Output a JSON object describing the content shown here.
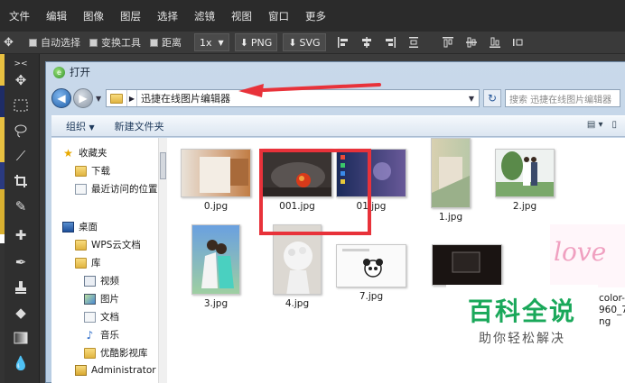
{
  "menu": [
    "文件",
    "编辑",
    "图像",
    "图层",
    "选择",
    "滤镜",
    "视图",
    "窗口",
    "更多"
  ],
  "options": {
    "auto_select": "自动选择",
    "transform_tools": "变换工具",
    "distance": "距离",
    "zoom": "1x",
    "export_png": "PNG",
    "export_svg": "SVG"
  },
  "dialog": {
    "title": "打开",
    "address": "迅捷在线图片编辑器",
    "search_placeholder": "搜索 迅捷在线图片编辑器",
    "organize": "组织",
    "new_folder": "新建文件夹"
  },
  "nav_items": [
    {
      "label": "收藏夹",
      "icon": "star-icon"
    },
    {
      "label": "下载",
      "icon": "folder-icon"
    },
    {
      "label": "最近访问的位置",
      "icon": "recent-places-icon"
    },
    {
      "label": "桌面",
      "icon": "desktop-icon"
    },
    {
      "label": "WPS云文档",
      "icon": "folder-icon"
    },
    {
      "label": "库",
      "icon": "library-icon"
    },
    {
      "label": "视频",
      "icon": "video-icon"
    },
    {
      "label": "图片",
      "icon": "picture-icon"
    },
    {
      "label": "文档",
      "icon": "document-icon"
    },
    {
      "label": "音乐",
      "icon": "music-icon"
    },
    {
      "label": "优酷影视库",
      "icon": "folder-icon"
    },
    {
      "label": "Administrator",
      "icon": "user-folder-icon"
    }
  ],
  "files": [
    {
      "name": "0.jpg"
    },
    {
      "name": "001.jpg"
    },
    {
      "name": "01.jpg"
    },
    {
      "name": "1.jpg"
    },
    {
      "name": "2.jpg"
    },
    {
      "name": "3.jpg"
    },
    {
      "name": "4.jpg"
    },
    {
      "name": "7.jpg"
    },
    {
      "name": "color-"
    },
    {
      "name": "960_7"
    },
    {
      "name": "ng"
    }
  ],
  "watermark": {
    "title": "百科全说",
    "subtitle": "助你轻松解决"
  },
  "colors": {
    "highlight": "#e8323a",
    "watermark_green": "#1aa85a"
  }
}
